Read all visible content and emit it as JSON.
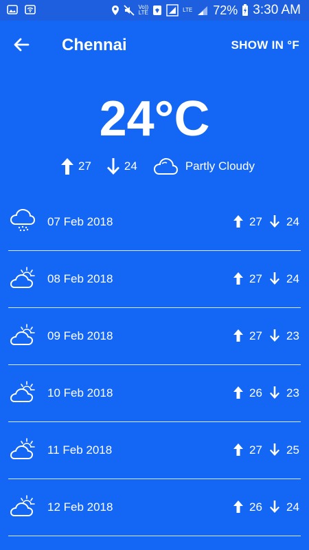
{
  "status_bar": {
    "volte_label": "Vo))",
    "lte_label": "LTE",
    "lte2_label": "LTE",
    "battery_percent": "72%",
    "time": "3:30 AM"
  },
  "header": {
    "city": "Chennai",
    "unit_toggle_label": "SHOW IN °F"
  },
  "current": {
    "temperature": "24°C",
    "high": "27",
    "low": "24",
    "condition": "Partly Cloudy",
    "condition_icon": "cloud-icon"
  },
  "forecast": [
    {
      "date": "07 Feb 2018",
      "high": "27",
      "low": "24",
      "icon": "snow-cloud-icon"
    },
    {
      "date": "08 Feb 2018",
      "high": "27",
      "low": "24",
      "icon": "partly-cloudy-icon"
    },
    {
      "date": "09 Feb 2018",
      "high": "27",
      "low": "23",
      "icon": "partly-cloudy-icon"
    },
    {
      "date": "10 Feb 2018",
      "high": "26",
      "low": "23",
      "icon": "partly-cloudy-icon"
    },
    {
      "date": "11 Feb 2018",
      "high": "27",
      "low": "25",
      "icon": "partly-cloudy-icon"
    },
    {
      "date": "12 Feb 2018",
      "high": "26",
      "low": "24",
      "icon": "partly-cloudy-icon"
    }
  ],
  "colors": {
    "background": "#1466f5",
    "status_bar": "#1e5fe0",
    "text": "#ffffff"
  }
}
